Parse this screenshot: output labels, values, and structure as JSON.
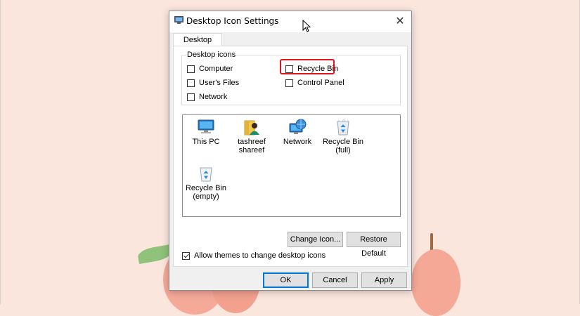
{
  "dialog": {
    "title": "Desktop Icon Settings",
    "close_glyph": "✕",
    "tab_label": "Desktop Icons"
  },
  "group": {
    "label": "Desktop icons",
    "checkboxes": [
      {
        "label": "Computer",
        "checked": false
      },
      {
        "label": "User's Files",
        "checked": false
      },
      {
        "label": "Network",
        "checked": false
      },
      {
        "label": "Recycle Bin",
        "checked": false,
        "highlighted": true
      },
      {
        "label": "Control Panel",
        "checked": false
      }
    ]
  },
  "icons": [
    {
      "line1": "This PC",
      "line2": "",
      "icon": "this-pc-icon"
    },
    {
      "line1": "tashreef",
      "line2": "shareef",
      "icon": "user-folder-icon"
    },
    {
      "line1": "Network",
      "line2": "",
      "icon": "network-icon"
    },
    {
      "line1": "Recycle Bin",
      "line2": "(full)",
      "icon": "recycle-bin-full-icon"
    },
    {
      "line1": "Recycle Bin",
      "line2": "(empty)",
      "icon": "recycle-bin-empty-icon"
    }
  ],
  "buttons": {
    "change_icon": "Change Icon...",
    "restore_default": "Restore Default",
    "ok": "OK",
    "cancel": "Cancel",
    "apply": "Apply"
  },
  "themes_checkbox": {
    "label": "Allow themes to change desktop icons",
    "checked": true
  },
  "colors": {
    "highlight": "#e0141e",
    "accent": "#0078d7",
    "background": "#fbe6de"
  }
}
